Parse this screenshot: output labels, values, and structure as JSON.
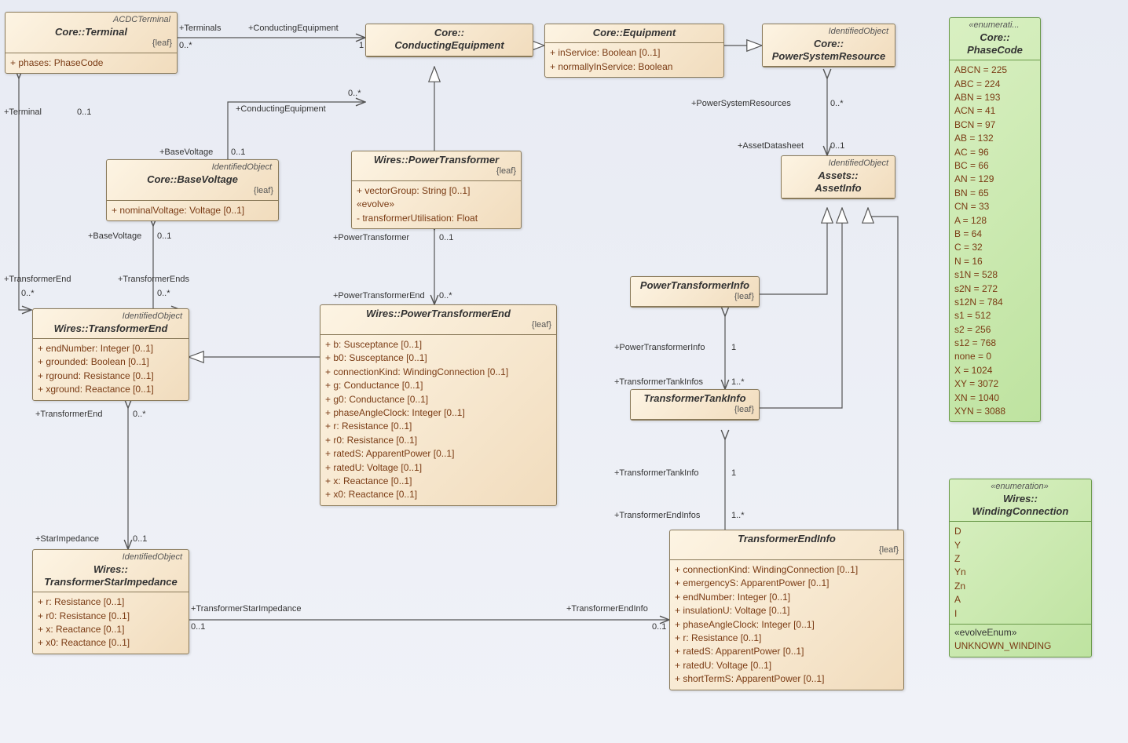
{
  "classes": {
    "terminal": {
      "stereo": "ACDCTerminal",
      "title": "Core::Terminal",
      "constraint": "{leaf}",
      "attrs": [
        "+  phases: PhaseCode"
      ]
    },
    "conductingEquipment": {
      "title": "Core::\nConductingEquipment"
    },
    "equipment": {
      "title": "Core::Equipment",
      "attrs": [
        "+  inService: Boolean [0..1]",
        "+  normallyInService: Boolean"
      ]
    },
    "psr": {
      "stereo": "IdentifiedObject",
      "title": "Core::\nPowerSystemResource"
    },
    "baseVoltage": {
      "stereo": "IdentifiedObject",
      "title": "Core::BaseVoltage",
      "constraint": "{leaf}",
      "attrs": [
        "+  nominalVoltage: Voltage [0..1]"
      ]
    },
    "powerTransformer": {
      "title": "Wires::PowerTransformer",
      "constraint": "{leaf}",
      "attrs": [
        "+  vectorGroup: String [0..1]",
        "«evolve»",
        "-  transformerUtilisation: Float"
      ]
    },
    "assetInfo": {
      "stereo": "IdentifiedObject",
      "title": "Assets::\nAssetInfo"
    },
    "transformerEnd": {
      "stereo": "IdentifiedObject",
      "title": "Wires::TransformerEnd",
      "attrs": [
        "+  endNumber: Integer [0..1]",
        "+  grounded: Boolean [0..1]",
        "+  rground: Resistance [0..1]",
        "+  xground: Reactance [0..1]"
      ]
    },
    "powerTransformerEnd": {
      "title": "Wires::PowerTransformerEnd",
      "constraint": "{leaf}",
      "attrs": [
        "+  b: Susceptance [0..1]",
        "+  b0: Susceptance [0..1]",
        "+  connectionKind: WindingConnection [0..1]",
        "+  g: Conductance [0..1]",
        "+  g0: Conductance [0..1]",
        "+  phaseAngleClock: Integer [0..1]",
        "+  r: Resistance [0..1]",
        "+  r0: Resistance [0..1]",
        "+  ratedS: ApparentPower [0..1]",
        "+  ratedU: Voltage [0..1]",
        "+  x: Reactance [0..1]",
        "+  x0: Reactance [0..1]"
      ]
    },
    "starImpedance": {
      "stereo": "IdentifiedObject",
      "title": "Wires::\nTransformerStarImpedance",
      "attrs": [
        "+  r: Resistance [0..1]",
        "+  r0: Resistance [0..1]",
        "+  x: Reactance [0..1]",
        "+  x0: Reactance [0..1]"
      ]
    },
    "ptInfo": {
      "title": "PowerTransformerInfo",
      "constraint": "{leaf}"
    },
    "ttInfo": {
      "title": "TransformerTankInfo",
      "constraint": "{leaf}"
    },
    "teInfo": {
      "title": "TransformerEndInfo",
      "constraint": "{leaf}",
      "attrs": [
        "+  connectionKind: WindingConnection [0..1]",
        "+  emergencyS: ApparentPower [0..1]",
        "+  endNumber: Integer [0..1]",
        "+  insulationU: Voltage [0..1]",
        "+  phaseAngleClock: Integer [0..1]",
        "+  r: Resistance [0..1]",
        "+  ratedS: ApparentPower [0..1]",
        "+  ratedU: Voltage [0..1]",
        "+  shortTermS: ApparentPower [0..1]"
      ]
    },
    "phaseCode": {
      "stereo": "«enumerati...",
      "title": "Core::\nPhaseCode",
      "attrs": [
        "ABCN = 225",
        "ABC = 224",
        "ABN = 193",
        "ACN = 41",
        "BCN = 97",
        "AB = 132",
        "AC = 96",
        "BC = 66",
        "AN = 129",
        "BN = 65",
        "CN = 33",
        "A = 128",
        "B = 64",
        "C = 32",
        "N = 16",
        "s1N = 528",
        "s2N = 272",
        "s12N = 784",
        "s1 = 512",
        "s2 = 256",
        "s12 = 768",
        "none = 0",
        "X = 1024",
        "XY = 3072",
        "XN = 1040",
        "XYN = 3088"
      ]
    },
    "windingConn": {
      "stereo": "«enumeration»",
      "title": "Wires::\nWindingConnection",
      "attrs": [
        "D",
        "Y",
        "Z",
        "Yn",
        "Zn",
        "A",
        "I"
      ],
      "evolveHeader": "«evolveEnum»",
      "evolveAttrs": [
        "UNKNOWN_WINDING"
      ]
    }
  },
  "associations": {
    "termToCE": {
      "roleA": "+Terminals",
      "multA": "0..*",
      "roleB": "+ConductingEquipment",
      "multB": "1"
    },
    "ceToEquip": {},
    "equipToPSR": {},
    "baseVoltCE": {
      "roleA": "+BaseVoltage",
      "multA": "0..1",
      "roleB": "+ConductingEquipment",
      "multB": "0..*"
    },
    "psrAsset": {
      "roleA": "+PowerSystemResources",
      "multA": "0..*",
      "roleB": "+AssetDatasheet",
      "multB": "0..1"
    },
    "teTerminal": {
      "roleA": "+Terminal",
      "multA": "0..1",
      "roleB": "+TransformerEnd",
      "multB": "0..*"
    },
    "teBaseVolt": {
      "roleA": "+BaseVoltage",
      "multA": "0..1",
      "roleB": "+TransformerEnds",
      "multB": "0..*"
    },
    "ptToCE": {},
    "ptPTE": {
      "roleA": "+PowerTransformer",
      "multA": "0..1",
      "roleB": "+PowerTransformerEnd",
      "multB": "0..*"
    },
    "pteToTE": {},
    "teStar": {
      "roleA": "+TransformerEnd",
      "multA": "0..*",
      "roleB": "+StarImpedance",
      "multB": "0..1"
    },
    "starTEI": {
      "roleA": "+TransformerStarImpedance",
      "multA": "0..1",
      "roleB": "+TransformerEndInfo",
      "multB": "0..1"
    },
    "ptiToAsset": {},
    "ttiToAsset": {},
    "teiToAsset": {},
    "ptiTti": {
      "roleA": "+PowerTransformerInfo",
      "multA": "1",
      "roleB": "+TransformerTankInfos",
      "multB": "1..*"
    },
    "ttiTei": {
      "roleA": "+TransformerTankInfo",
      "multA": "1",
      "roleB": "+TransformerEndInfos",
      "multB": "1..*"
    }
  }
}
